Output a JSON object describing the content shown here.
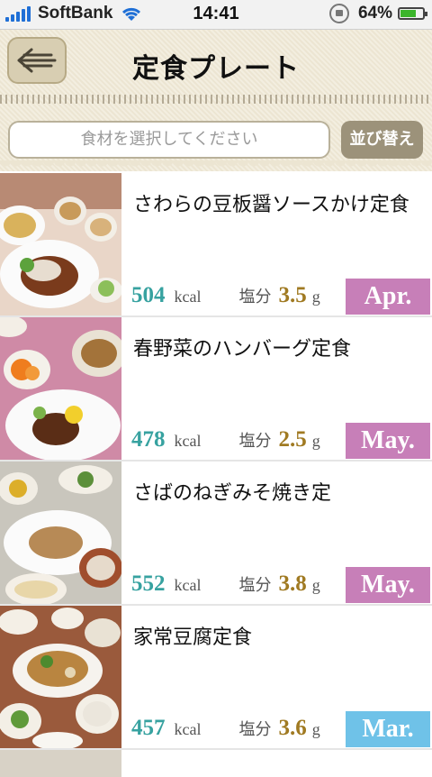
{
  "status": {
    "carrier": "SoftBank",
    "time": "14:41",
    "battery": "64%",
    "battery_level": 0.64
  },
  "header": {
    "title": "定食プレート",
    "back_icon": "back-arrow-icon"
  },
  "search": {
    "placeholder": "食材を選択してください",
    "sort_label": "並び替え"
  },
  "colors": {
    "kcal": "#37a2a0",
    "salt": "#a07a22",
    "apr": "#c77fb8",
    "may": "#c77fb8",
    "mar": "#6fc2e8"
  },
  "items": [
    {
      "name": "さわらの豆板醤ソースかけ定食",
      "kcal": "504",
      "kcal_unit": "kcal",
      "salt_label": "塩分",
      "salt": "3.5",
      "salt_unit": "g",
      "month": "Apr.",
      "month_color": "#c77fb8"
    },
    {
      "name": "春野菜のハンバーグ定食",
      "kcal": "478",
      "kcal_unit": "kcal",
      "salt_label": "塩分",
      "salt": "2.5",
      "salt_unit": "g",
      "month": "May.",
      "month_color": "#c77fb8"
    },
    {
      "name": "さばのねぎみそ焼き定",
      "kcal": "552",
      "kcal_unit": "kcal",
      "salt_label": "塩分",
      "salt": "3.8",
      "salt_unit": "g",
      "month": "May.",
      "month_color": "#c77fb8"
    },
    {
      "name": "家常豆腐定食",
      "kcal": "457",
      "kcal_unit": "kcal",
      "salt_label": "塩分",
      "salt": "3.6",
      "salt_unit": "g",
      "month": "Mar.",
      "month_color": "#6fc2e8"
    }
  ]
}
